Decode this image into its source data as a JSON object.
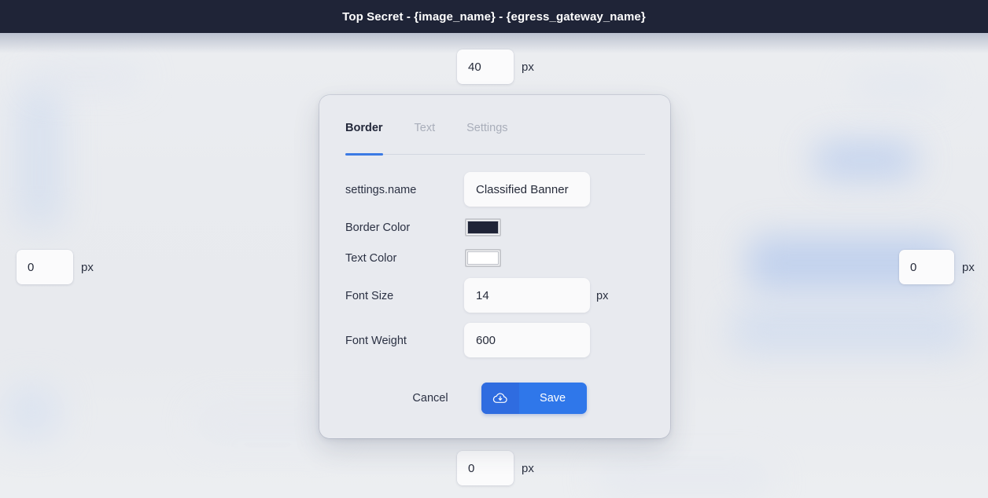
{
  "banner": {
    "title": "Top Secret - {image_name} - {egress_gateway_name}",
    "background_color": "#1f2437",
    "text_color": "#ffffff"
  },
  "padding_controls": {
    "top": {
      "name": "padding-top",
      "value": "40",
      "unit": "px"
    },
    "left": {
      "name": "padding-left",
      "value": "0",
      "unit": "px"
    },
    "right": {
      "name": "padding-right",
      "value": "0",
      "unit": "px"
    },
    "bottom": {
      "name": "padding-bottom",
      "value": "0",
      "unit": "px"
    }
  },
  "dialog": {
    "tabs": [
      {
        "label": "Border",
        "active": true,
        "icon": ""
      },
      {
        "label": "Text",
        "active": false,
        "icon": ""
      },
      {
        "label": "Settings",
        "active": false,
        "icon": ""
      }
    ],
    "accent_color": "#3b7ae4",
    "fields": {
      "name": {
        "label": "settings.name",
        "value": "Classified Banner",
        "placeholder": "settings.name"
      },
      "border_color": {
        "label": "Border Color",
        "value": "#1f2437"
      },
      "text_color": {
        "label": "Text Color",
        "value": "#ffffff"
      },
      "font_size": {
        "label": "Font Size",
        "value": "14",
        "unit": "px",
        "placeholder": "14"
      },
      "font_weight": {
        "label": "Font Weight",
        "value": "600",
        "placeholder": "600"
      }
    },
    "footer": {
      "cancel_label": "Cancel",
      "save_label": "Save",
      "save_icon": "cloud-download-icon",
      "save_color": "#2f77ea"
    }
  }
}
